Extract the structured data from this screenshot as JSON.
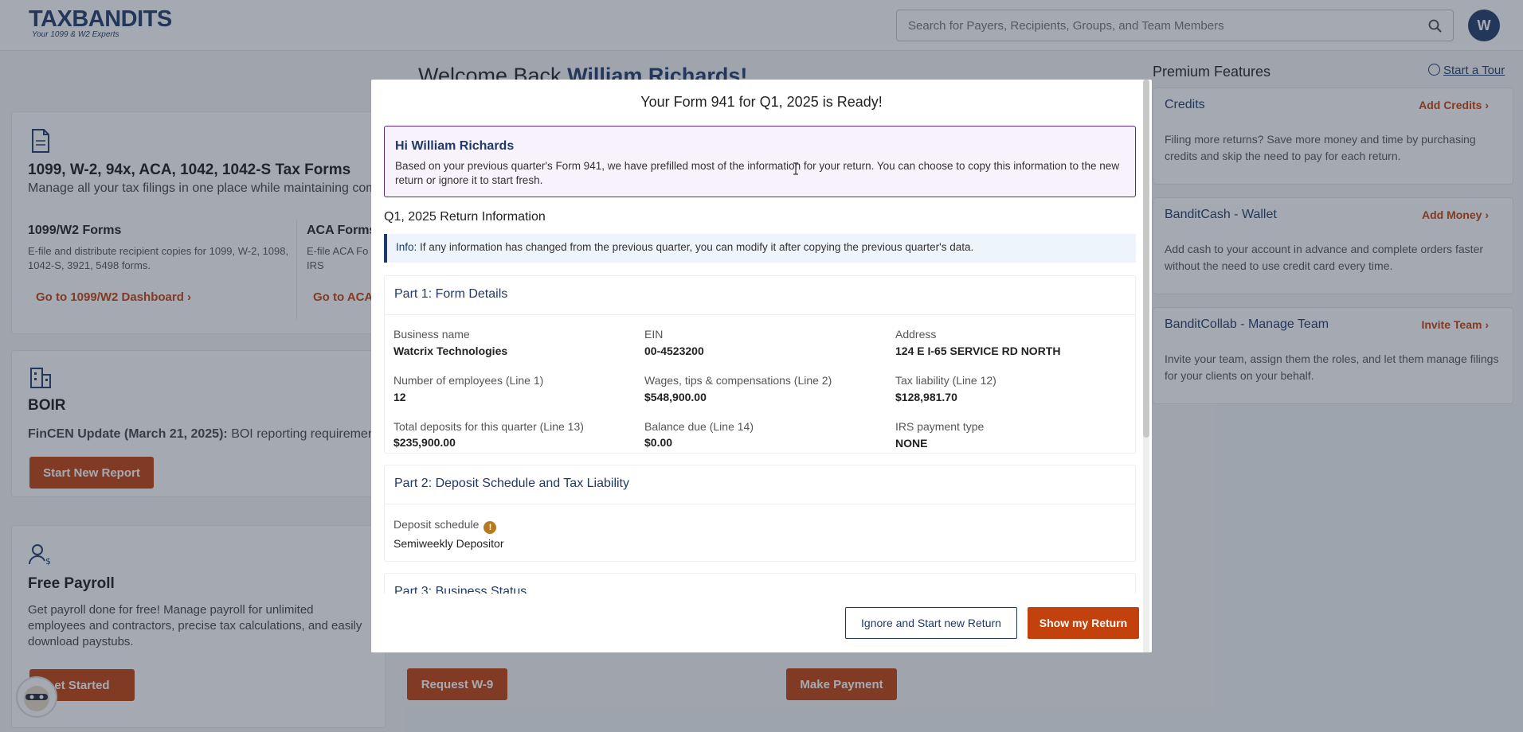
{
  "header": {
    "logo_text": "TAXBANDITS",
    "logo_tagline": "Your 1099 & W2 Experts",
    "search_placeholder": "Search for Payers, Recipients, Groups, and Team Members",
    "avatar_initial": "W"
  },
  "welcome": {
    "prefix": "Welcome Back",
    "name": "William Richards!"
  },
  "tax_forms_card": {
    "title": "1099, W-2, 94x, ACA, 1042, 1042-S Tax Forms",
    "subtitle": "Manage all your tax filings in one place while maintaining com",
    "sections": [
      {
        "heading": "1099/W2 Forms",
        "text": "E-file and distribute recipient copies for 1099, W-2, 1098, 1042-S, 3921, 5498 forms.",
        "link": "Go to 1099/W2 Dashboard"
      },
      {
        "heading": "ACA Forms",
        "text": "E-file ACA Fo IRS",
        "link": "Go to ACA"
      }
    ]
  },
  "boir_card": {
    "title": "BOIR",
    "update_bold": "FinCEN Update (March 21, 2025):",
    "update_text": "BOI reporting requirement",
    "button": "Start New Report"
  },
  "payroll_card": {
    "title": "Free Payroll",
    "text": "Get payroll done for free! Manage payroll for unlimited employees and contractors, precise tax calculations, and easily download paystubs.",
    "button": "et Started"
  },
  "other_buttons": {
    "request_w9": "Request W-9",
    "make_payment": "Make Payment"
  },
  "premium": {
    "title": "Premium Features",
    "tour": "Start a Tour",
    "cards": [
      {
        "title": "Credits",
        "action": "Add Credits",
        "text": "Filing more returns? Save more money and time by purchasing credits and skip the need to pay for each return."
      },
      {
        "title": "BanditCash - Wallet",
        "action": "Add Money",
        "text": "Add cash to your account in advance and complete orders faster without the need to use credit card every time."
      },
      {
        "title": "BanditCollab - Manage Team",
        "action": "Invite Team",
        "text": "Invite your team, assign them the roles, and let them manage filings for your clients on your behalf."
      }
    ]
  },
  "modal": {
    "title": "Your Form 941 for Q1, 2025 is Ready!",
    "greeting": "Hi William Richards",
    "greeting_text": "Based on your previous quarter's Form 941, we have prefilled most of the information for your return. You can choose to copy this information to the new return or ignore it to start fresh.",
    "section_title": "Q1, 2025 Return Information",
    "info_label": "Info:",
    "info_text": "If any information has changed from the previous quarter, you can modify it after copying the previous quarter's data.",
    "part1": {
      "title": "Part 1: Form Details",
      "fields": [
        {
          "label": "Business name",
          "value": "Watcrix Technologies"
        },
        {
          "label": "EIN",
          "value": "00-4523200"
        },
        {
          "label": "Address",
          "value": "124 E I-65 SERVICE RD NORTH"
        },
        {
          "label": "Number of employees (Line 1)",
          "value": "12"
        },
        {
          "label": "Wages, tips & compensations (Line 2)",
          "value": "$548,900.00"
        },
        {
          "label": "Tax liability (Line 12)",
          "value": "$128,981.70"
        },
        {
          "label": "Total deposits for this quarter (Line 13)",
          "value": "$235,900.00"
        },
        {
          "label": "Balance due (Line 14)",
          "value": "$0.00"
        },
        {
          "label": "IRS payment type",
          "value": "NONE"
        }
      ]
    },
    "part2": {
      "title": "Part 2: Deposit Schedule and Tax Liability",
      "label": "Deposit schedule",
      "value": "Semiweekly Depositor"
    },
    "part3": {
      "title": "Part 3: Business Status"
    },
    "ignore_button": "Ignore and Start new Return",
    "show_button": "Show my Return"
  }
}
